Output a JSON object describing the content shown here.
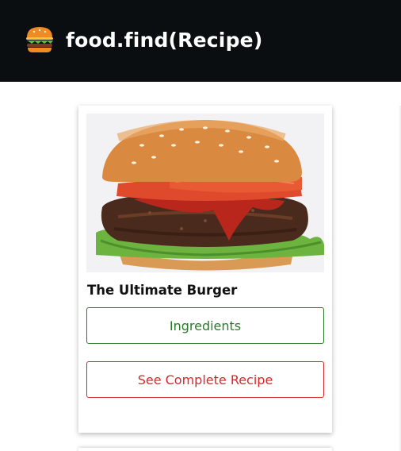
{
  "navbar": {
    "brand": "food.find(Recipe)",
    "logo_icon": "burger-logo-icon",
    "background": "#0b0e10"
  },
  "recipe_card": {
    "title": "The Ultimate Burger",
    "image_icon": "burger-photo",
    "ingredients_label": "Ingredients",
    "recipe_label": "See Complete Recipe",
    "colors": {
      "ingredients": "#2a7a2a",
      "recipe": "#d62828"
    }
  }
}
